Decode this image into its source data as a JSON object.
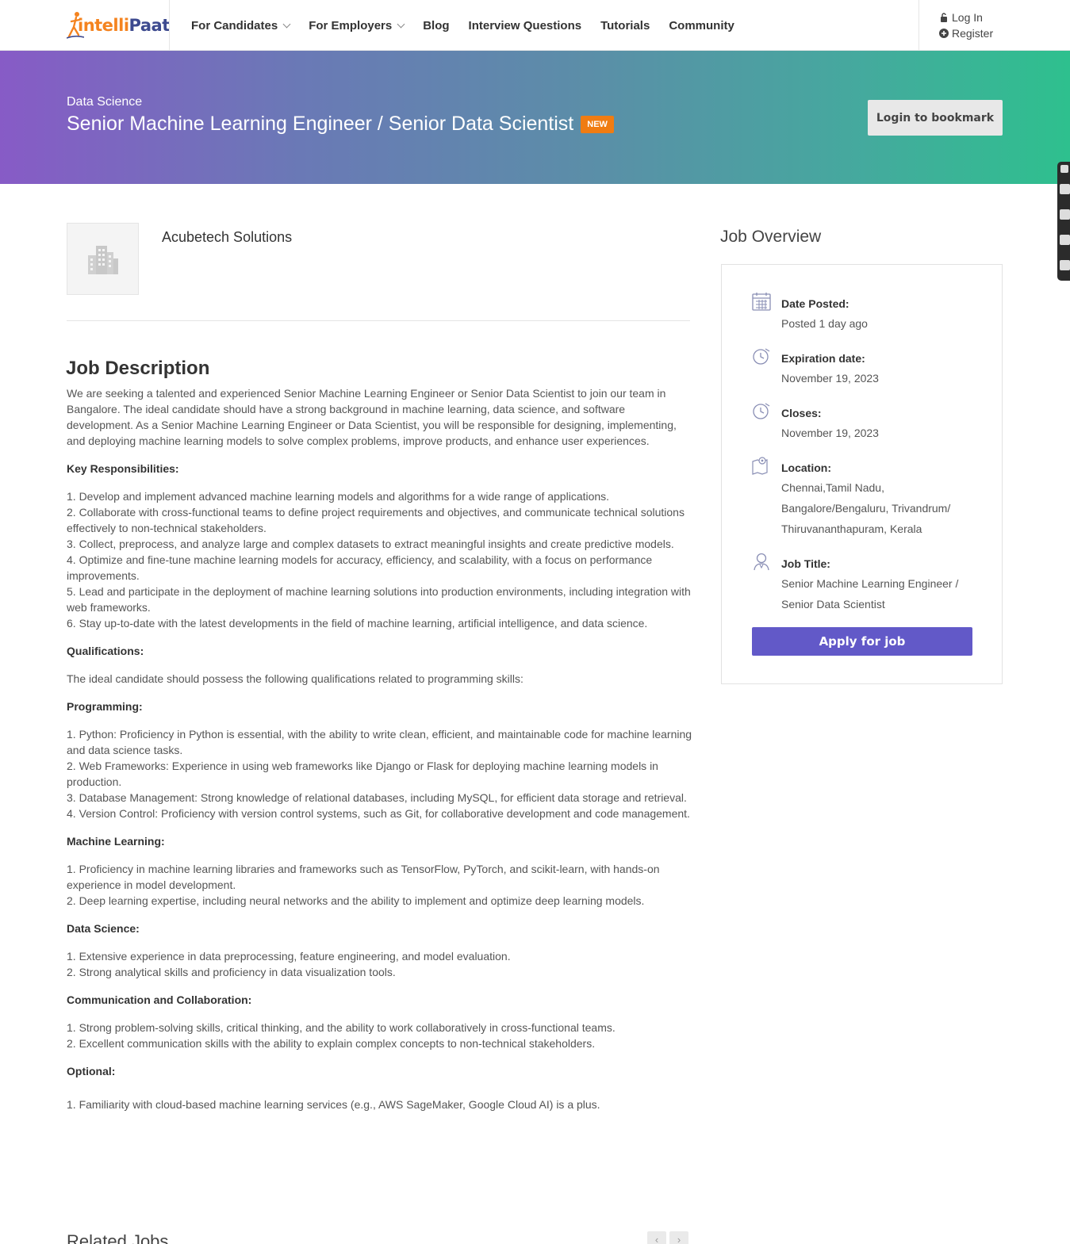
{
  "header": {
    "logo": {
      "part1": "intelli",
      "part2": "Paat"
    },
    "nav": [
      {
        "label": "For Candidates",
        "dropdown": true
      },
      {
        "label": "For Employers",
        "dropdown": true
      },
      {
        "label": "Blog",
        "dropdown": false
      },
      {
        "label": "Interview Questions",
        "dropdown": false
      },
      {
        "label": "Tutorials",
        "dropdown": false
      },
      {
        "label": "Community",
        "dropdown": false
      }
    ],
    "login_label": "Log In",
    "register_label": "Register"
  },
  "banner": {
    "category": "Data Science",
    "title": "Senior Machine Learning Engineer / Senior Data Scientist",
    "badge": "NEW",
    "bookmark_label": "Login to bookmark"
  },
  "company": {
    "name": "Acubetech Solutions"
  },
  "description": {
    "heading": "Job Description",
    "intro": "We are seeking a talented and experienced Senior Machine Learning Engineer or Senior Data Scientist to join our team in Bangalore. The ideal candidate should have a strong background in machine learning, data science, and software development. As a Senior Machine Learning Engineer or Data Scientist, you will be responsible for designing, implementing, and deploying machine learning models to solve complex problems, improve products, and enhance user experiences.",
    "responsibilities_heading": "Key Responsibilities:",
    "responsibilities": [
      "1. Develop and implement advanced machine learning models and algorithms for a wide range of applications.",
      "2. Collaborate with cross-functional teams to define project requirements and objectives, and communicate technical solutions effectively to non-technical stakeholders.",
      "3. Collect, preprocess, and analyze large and complex datasets to extract meaningful insights and create predictive models.",
      "4. Optimize and fine-tune machine learning models for accuracy, efficiency, and scalability, with a focus on performance improvements.",
      "5. Lead and participate in the deployment of machine learning solutions into production environments, including integration with web frameworks.",
      "6. Stay up-to-date with the latest developments in the field of machine learning, artificial intelligence, and data science."
    ],
    "qualifications_heading": "Qualifications:",
    "qualifications_intro": "The ideal candidate should possess the following qualifications related to programming skills:",
    "programming_heading": "Programming:",
    "programming": [
      "1. Python: Proficiency in Python is essential, with the ability to write clean, efficient, and maintainable code for machine learning and data science tasks.",
      "2. Web Frameworks: Experience in using web frameworks like Django or Flask for deploying machine learning models in production.",
      "3. Database Management: Strong knowledge of relational databases, including MySQL, for efficient data storage and retrieval.",
      "4. Version Control: Proficiency with version control systems, such as Git, for collaborative development and code management."
    ],
    "ml_heading": "Machine Learning:",
    "ml": [
      "1. Proficiency in machine learning libraries and frameworks such as TensorFlow, PyTorch, and scikit-learn, with hands-on experience in model development.",
      "2. Deep learning expertise, including neural networks and the ability to implement and optimize deep learning models."
    ],
    "ds_heading": "Data Science:",
    "ds": [
      "1. Extensive experience in data preprocessing, feature engineering, and model evaluation.",
      "2. Strong analytical skills and proficiency in data visualization tools."
    ],
    "comm_heading": "Communication and Collaboration:",
    "comm": [
      "1. Strong problem-solving skills, critical thinking, and the ability to work collaboratively in cross-functional teams.",
      "2. Excellent communication skills with the ability to explain complex concepts to non-technical stakeholders."
    ],
    "optional_heading": "Optional:",
    "optional": [
      "1.  Familiarity with cloud-based machine learning services (e.g., AWS SageMaker, Google Cloud AI) is a plus."
    ]
  },
  "related": {
    "heading": "Related Jobs"
  },
  "overview": {
    "heading": "Job Overview",
    "date_posted_label": "Date Posted:",
    "date_posted_value": "Posted 1 day ago",
    "expiration_label": "Expiration date:",
    "expiration_value": "November 19, 2023",
    "closes_label": "Closes:",
    "closes_value": "November 19, 2023",
    "location_label": "Location:",
    "location_value": "Chennai,Tamil Nadu, Bangalore/Bengaluru, Trivandrum/ Thiruvananthapuram, Kerala",
    "job_title_label": "Job Title:",
    "job_title_value": "Senior Machine Learning Engineer / Senior Data Scientist",
    "apply_label": "Apply for job"
  },
  "colors": {
    "accent_orange": "#f07c12",
    "apply_purple": "#6259c8",
    "banner_start": "#875bc6",
    "banner_end": "#2ec08e"
  }
}
